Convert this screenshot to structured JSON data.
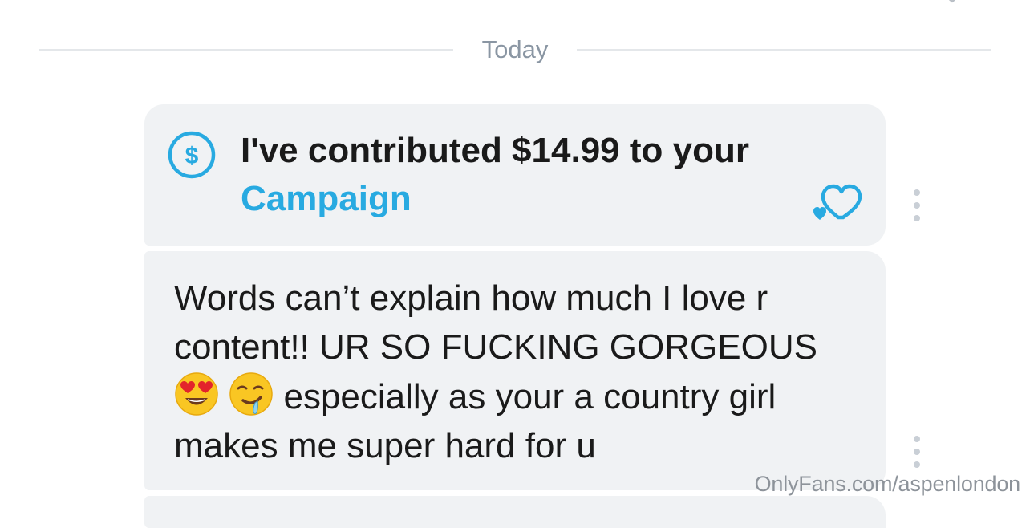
{
  "date_divider": {
    "label": "Today"
  },
  "tip_message": {
    "icon": "dollar-circle-icon",
    "text": "I've contributed $14.99 to your",
    "link_text": "Campaign",
    "like_icon": "heart-outline-icon"
  },
  "text_message": {
    "lines": [
      "Words can’t explain how much I love r",
      "content!! UR SO FUCKING GORGEOUS",
      "especially as your a country girl",
      "makes me super hard for u"
    ],
    "emojis": [
      "heart-eyes-emoji",
      "drooling-face-emoji"
    ]
  },
  "watermark": {
    "text": "OnlyFans.com/aspenlondon"
  },
  "colors": {
    "bubble": "#f0f2f4",
    "accent": "#28aae1",
    "divider_text": "#8a96a3",
    "text": "#1a1a1a",
    "menu_dots": "#c9cfd6"
  }
}
